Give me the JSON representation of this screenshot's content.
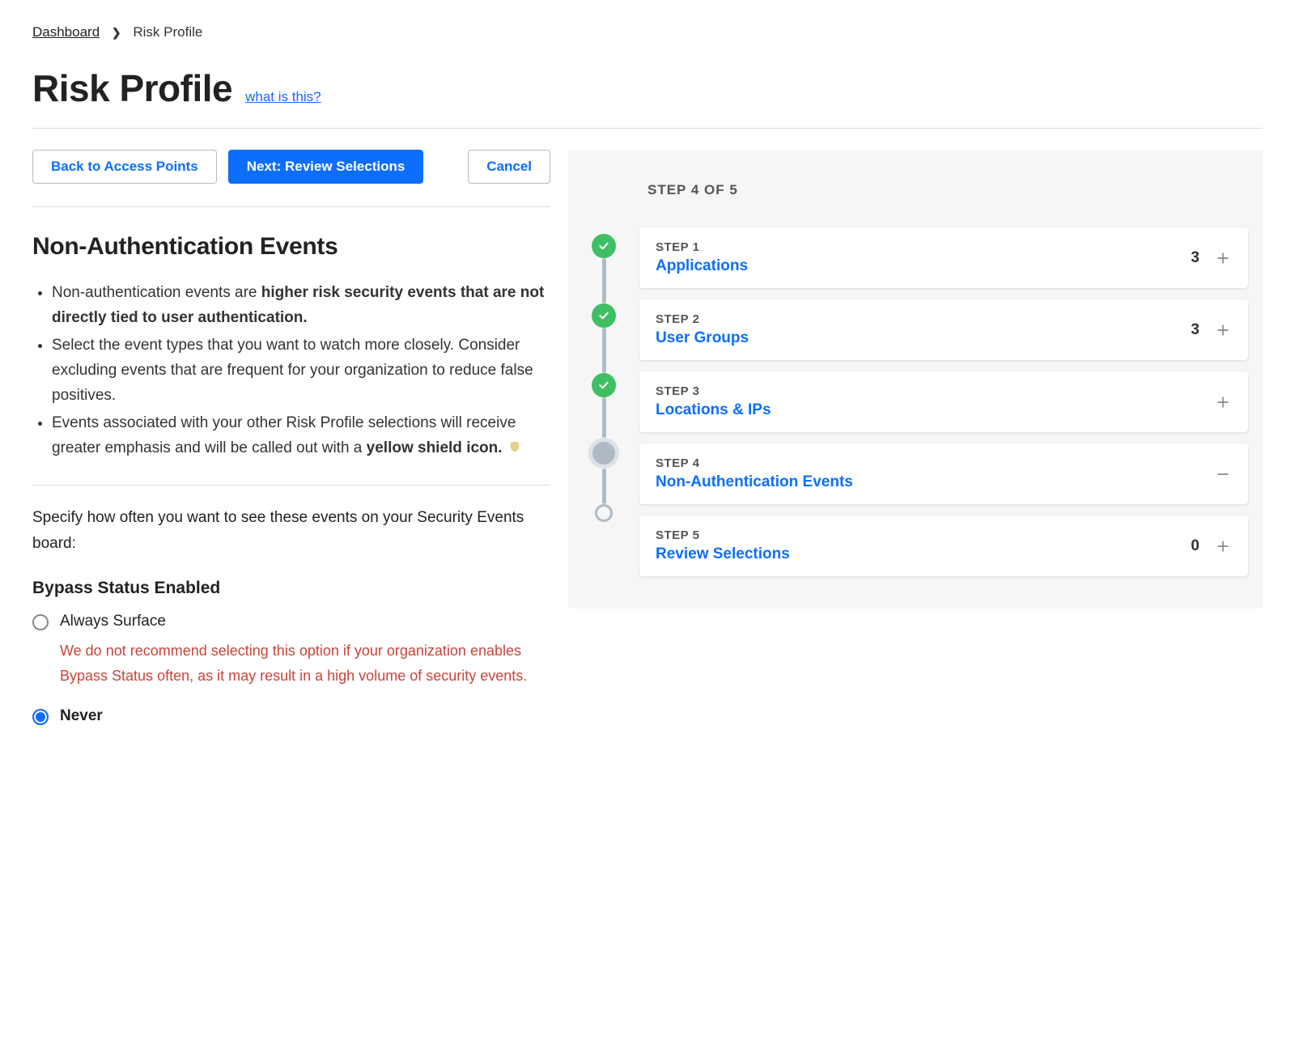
{
  "breadcrumb": {
    "root": "Dashboard",
    "current": "Risk Profile"
  },
  "page": {
    "title": "Risk Profile",
    "help_link": "what is this?"
  },
  "buttons": {
    "back": "Back to Access Points",
    "next": "Next: Review Selections",
    "cancel": "Cancel"
  },
  "section": {
    "title": "Non-Authentication Events",
    "bullet1_pre": "Non-authentication events are ",
    "bullet1_bold": "higher risk security events that are not directly tied to user authentication.",
    "bullet2": "Select the event types that you want to watch more closely. Consider excluding events that are frequent for your organization to reduce false positives.",
    "bullet3_pre": "Events associated with your other Risk Profile selections will receive greater emphasis and will be called out with a ",
    "bullet3_bold": "yellow shield icon."
  },
  "frequency": {
    "instruction": "Specify how often you want to see these events on your Security Events board:",
    "subsection": "Bypass Status Enabled",
    "option_always": "Always Surface",
    "warning": "We do not recommend selecting this option if your organization enables Bypass Status often, as it may result in a high volume of security events.",
    "option_never": "Never"
  },
  "stepper": {
    "indicator": "STEP 4 OF 5",
    "steps": [
      {
        "label": "STEP 1",
        "title": "Applications",
        "count": "3",
        "state": "done",
        "toggle": "plus"
      },
      {
        "label": "STEP 2",
        "title": "User Groups",
        "count": "3",
        "state": "done",
        "toggle": "plus"
      },
      {
        "label": "STEP 3",
        "title": "Locations & IPs",
        "count": "",
        "state": "done",
        "toggle": "plus"
      },
      {
        "label": "STEP 4",
        "title": "Non-Authentication Events",
        "count": "",
        "state": "current",
        "toggle": "minus"
      },
      {
        "label": "STEP 5",
        "title": "Review Selections",
        "count": "0",
        "state": "future",
        "toggle": "plus"
      }
    ]
  }
}
